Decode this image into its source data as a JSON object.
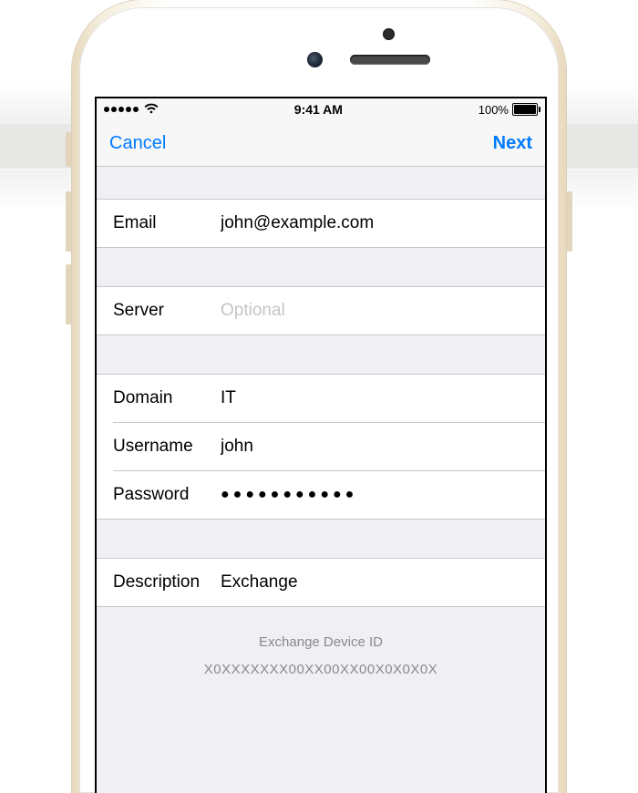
{
  "status": {
    "time": "9:41 AM",
    "battery": "100%"
  },
  "nav": {
    "cancel": "Cancel",
    "next": "Next"
  },
  "fields": {
    "email": {
      "label": "Email",
      "value": "john@example.com"
    },
    "server": {
      "label": "Server",
      "value": "",
      "placeholder": "Optional"
    },
    "domain": {
      "label": "Domain",
      "value": "IT"
    },
    "username": {
      "label": "Username",
      "value": "john"
    },
    "password": {
      "label": "Password",
      "value": "●●●●●●●●●●●"
    },
    "description": {
      "label": "Description",
      "value": "Exchange"
    }
  },
  "footer": {
    "title": "Exchange Device ID",
    "device_id": "X0XXXXXXX00XX00XX00X0X0X0X"
  }
}
